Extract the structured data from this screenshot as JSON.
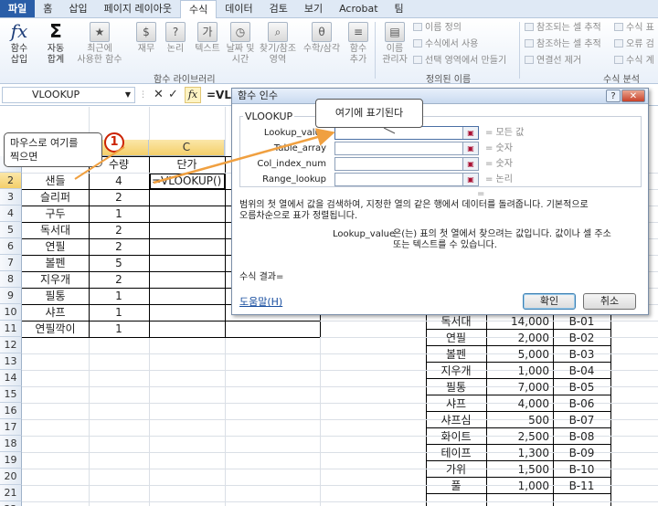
{
  "tabs": [
    "파일",
    "홈",
    "삽입",
    "페이지 레이아웃",
    "수식",
    "데이터",
    "검토",
    "보기",
    "Acrobat",
    "팀"
  ],
  "active_tab": "수식",
  "ribbon": {
    "insert_function": {
      "icon": "fx",
      "line1": "함수",
      "line2": "삽입"
    },
    "autosum": {
      "icon": "Σ",
      "line1": "자동",
      "line2": "합계"
    },
    "recent": {
      "line1": "최근에",
      "line2": "사용한 함수"
    },
    "financial": {
      "line1": "재무",
      "line2": ""
    },
    "logical": {
      "line1": "논리",
      "line2": ""
    },
    "text": {
      "line1": "텍스트",
      "line2": ""
    },
    "datetime": {
      "line1": "날짜 및",
      "line2": "시간"
    },
    "lookup": {
      "line1": "찾기/참조",
      "line2": "영역"
    },
    "math": {
      "line1": "수학/삼각",
      "line2": ""
    },
    "more": {
      "line1": "함수",
      "line2": "추가"
    },
    "group_library": "함수 라이브러리",
    "name_manager": {
      "line1": "이름",
      "line2": "관리자"
    },
    "define_name": "이름 정의",
    "use_in_formula": "수식에서 사용",
    "create_from_selection": "선택 영역에서 만들기",
    "group_names": "정의된 이름",
    "trace_precedents": "참조되는 셀 추적",
    "trace_dependents": "참조하는 셀 추적",
    "remove_arrows": "연결선 제거",
    "show_formulas": "수식 표",
    "error_check": "오류 검",
    "evaluate": "수식 계",
    "group_audit": "수식 분석"
  },
  "formula_bar": {
    "name_box": "VLOOKUP",
    "cancel_icon": "✕",
    "enter_icon": "✓",
    "fx": "fx",
    "text": "=VL"
  },
  "columns": [
    "B",
    "C"
  ],
  "rows": [
    "1",
    "2",
    "3",
    "4",
    "5",
    "6",
    "7",
    "8",
    "9",
    "10",
    "11",
    "12",
    "13",
    "14",
    "15",
    "16",
    "17",
    "18",
    "19",
    "20",
    "21",
    "22"
  ],
  "sheet": {
    "header_b": "수량",
    "header_c": "단가",
    "active_formula": "=VLOOKUP()",
    "items": [
      {
        "name": "샌들",
        "qty": "4"
      },
      {
        "name": "슬리퍼",
        "qty": "2"
      },
      {
        "name": "구두",
        "qty": "1"
      },
      {
        "name": "독서대",
        "qty": "2"
      },
      {
        "name": "연필",
        "qty": "2"
      },
      {
        "name": "볼펜",
        "qty": "5"
      },
      {
        "name": "지우개",
        "qty": "2"
      },
      {
        "name": "필통",
        "qty": "1"
      },
      {
        "name": "샤프",
        "qty": "1"
      },
      {
        "name": "연필깍이",
        "qty": "1"
      }
    ],
    "lookup_table": [
      {
        "name": "독서대",
        "price": "14,000",
        "code": "B-01"
      },
      {
        "name": "연필",
        "price": "2,000",
        "code": "B-02"
      },
      {
        "name": "볼펜",
        "price": "5,000",
        "code": "B-03"
      },
      {
        "name": "지우개",
        "price": "1,000",
        "code": "B-04"
      },
      {
        "name": "필통",
        "price": "7,000",
        "code": "B-05"
      },
      {
        "name": "샤프",
        "price": "4,000",
        "code": "B-06"
      },
      {
        "name": "샤프심",
        "price": "500",
        "code": "B-07"
      },
      {
        "name": "화이트",
        "price": "2,500",
        "code": "B-08"
      },
      {
        "name": "테이프",
        "price": "1,300",
        "code": "B-09"
      },
      {
        "name": "가위",
        "price": "1,500",
        "code": "B-10"
      },
      {
        "name": "풀",
        "price": "1,000",
        "code": "B-11"
      }
    ]
  },
  "callout1": {
    "line1": "마우스로 여기를",
    "line2": "찍으면",
    "badge": "1"
  },
  "callout2": "여기에 표기된다",
  "dialog": {
    "title": "함수 인수",
    "help": "?",
    "close": "✕",
    "function_name": "VLOOKUP",
    "args": [
      {
        "label": "Lookup_value",
        "value": "= 모든 값"
      },
      {
        "label": "Table_array",
        "value": "= 숫자"
      },
      {
        "label": "Col_index_num",
        "value": "= 숫자"
      },
      {
        "label": "Range_lookup",
        "value": "= 논리"
      }
    ],
    "result_eq": "=",
    "desc_line1": "범위의 첫 열에서 값을 검색하여, 지정한 열의 같은 행에서 데이터를 돌려줍니다. 기본적으로",
    "desc_line2": "오름차순으로 표가 정렬됩니다.",
    "arg_desc_name": "Lookup_value",
    "arg_desc_line1": "은(는) 표의 첫 열에서 찾으려는 값입니다. 값이나 셀 주소",
    "arg_desc_line2": "또는 텍스트를 수 있습니다.",
    "result_label": "수식 결과=",
    "help_link": "도움말(H)",
    "ok": "확인",
    "cancel": "취소"
  },
  "colors": {
    "file_tab": "#2a5ea8",
    "selected_header": "#f4cf6a",
    "arrow": "#f0a040",
    "badge": "#cc2200"
  }
}
